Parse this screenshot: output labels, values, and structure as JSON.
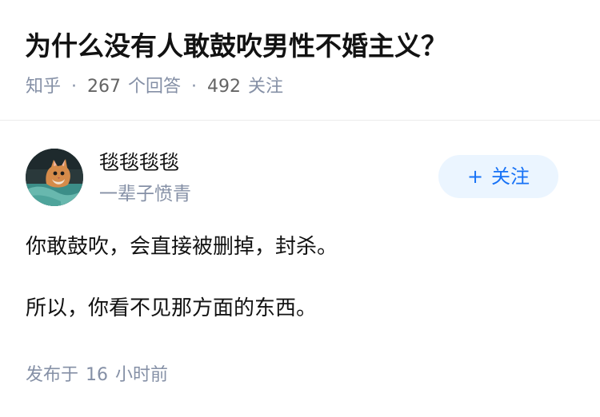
{
  "question": {
    "title": "为什么没有人敢鼓吹男性不婚主义？",
    "source": "知乎",
    "separator": "·",
    "answer_count": "267",
    "answer_label": "个回答",
    "follower_count": "492",
    "follower_label": "关注"
  },
  "author": {
    "name": "毯毯毯毯",
    "bio": "一辈子愤青",
    "avatar_icon": "cat-avatar-icon",
    "follow_button": {
      "icon": "+",
      "label": "关注"
    }
  },
  "answer": {
    "paragraphs": [
      "你敢鼓吹，会直接被删掉，封杀。",
      "所以，你看不见那方面的东西。"
    ],
    "published_prefix": "发布于",
    "published_amount": "16",
    "published_unit": "小时前"
  },
  "colors": {
    "title": "#121212",
    "meta": "#8590a6",
    "follow_background": "#ebf5ff",
    "follow_text": "#1772f6",
    "divider": "#ebebeb"
  }
}
